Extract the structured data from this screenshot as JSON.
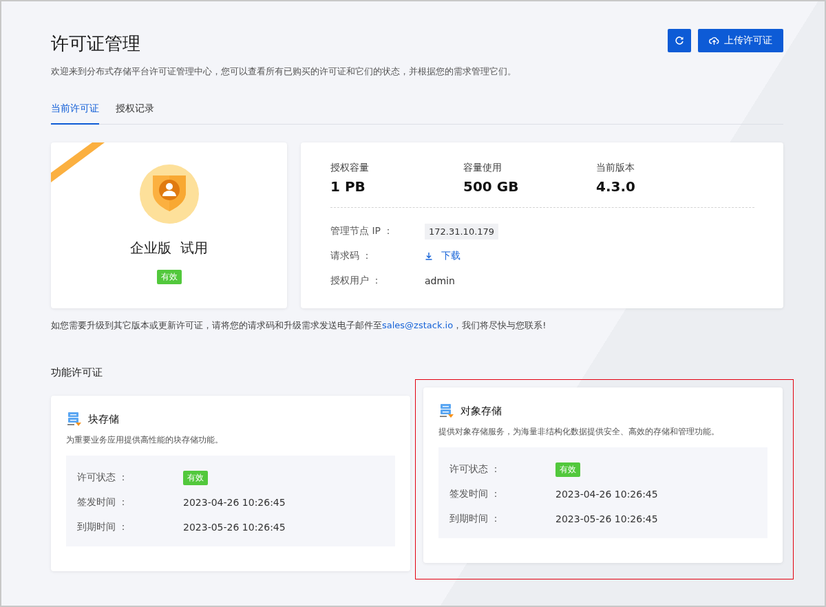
{
  "header": {
    "title": "许可证管理",
    "description": "欢迎来到分布式存储平台许可证管理中心，您可以查看所有已购买的许可证和它们的状态，并根据您的需求管理它们。",
    "refresh_button": true,
    "upload_button": "上传许可证"
  },
  "tabs": [
    {
      "label": "当前许可证",
      "selected": true
    },
    {
      "label": "授权记录",
      "selected": false
    }
  ],
  "edition_card": {
    "ribbon": true,
    "title": "企业版  试用",
    "status": "有效"
  },
  "info_card": {
    "stats": [
      {
        "label": "授权容量",
        "value": "1 PB"
      },
      {
        "label": "容量使用",
        "value": "500 GB"
      },
      {
        "label": "当前版本",
        "value": "4.3.0"
      }
    ],
    "details": [
      {
        "kind": "chip",
        "label": "管理节点 IP ：",
        "value": "172.31.10.179"
      },
      {
        "kind": "download",
        "label": "请求码 ：",
        "value": "下载"
      },
      {
        "kind": "text",
        "label": "授权用户 ：",
        "value": "admin"
      }
    ]
  },
  "note": {
    "before": "如您需要升级到其它版本或更新许可证，请将您的请求码和升级需求发送电子邮件至",
    "email": "sales@zstack.io",
    "after": "，我们将尽快与您联系!"
  },
  "features_title": "功能许可证",
  "features": [
    {
      "name": "块存储",
      "description": "为重要业务应用提供高性能的块存储功能。",
      "highlighted": false,
      "rows": [
        {
          "kind": "tag",
          "label": "许可状态 ：",
          "value": "有效"
        },
        {
          "kind": "text",
          "label": "签发时间 ：",
          "value": "2023-04-26 10:26:45"
        },
        {
          "kind": "text",
          "label": "到期时间 ：",
          "value": "2023-05-26 10:26:45"
        }
      ]
    },
    {
      "name": "对象存储",
      "description": "提供对象存储服务，为海量非结构化数据提供安全、高效的存储和管理功能。",
      "highlighted": true,
      "rows": [
        {
          "kind": "tag",
          "label": "许可状态 ：",
          "value": "有效"
        },
        {
          "kind": "text",
          "label": "签发时间 ：",
          "value": "2023-04-26 10:26:45"
        },
        {
          "kind": "text",
          "label": "到期时间 ：",
          "value": "2023-05-26 10:26:45"
        }
      ]
    }
  ]
}
